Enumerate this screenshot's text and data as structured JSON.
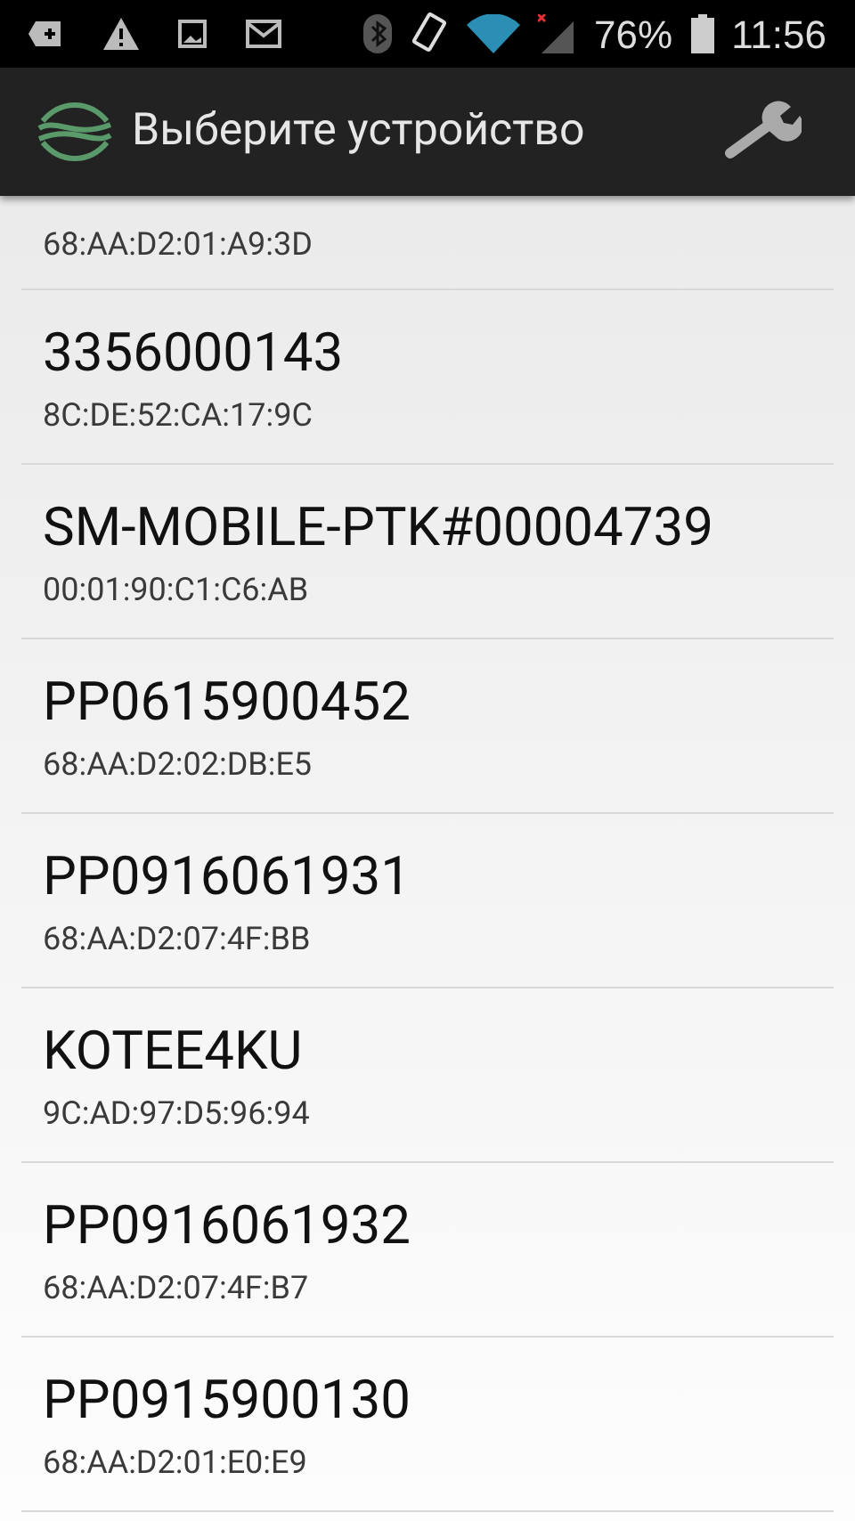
{
  "status_bar": {
    "battery": "76%",
    "time": "11:56"
  },
  "app_bar": {
    "title": "Выберите устройство"
  },
  "devices": [
    {
      "address": "68:AA:D2:01:A9:3D"
    },
    {
      "name": "3356000143",
      "address": "8C:DE:52:CA:17:9C"
    },
    {
      "name": "SM-MOBILE-PTK#00004739",
      "address": "00:01:90:C1:C6:AB"
    },
    {
      "name": "PP0615900452",
      "address": "68:AA:D2:02:DB:E5"
    },
    {
      "name": "PP0916061931",
      "address": "68:AA:D2:07:4F:BB"
    },
    {
      "name": "KOTEE4KU",
      "address": "9C:AD:97:D5:96:94"
    },
    {
      "name": "PP0916061932",
      "address": "68:AA:D2:07:4F:B7"
    },
    {
      "name": "PP0915900130",
      "address": "68:AA:D2:01:E0:E9"
    }
  ]
}
